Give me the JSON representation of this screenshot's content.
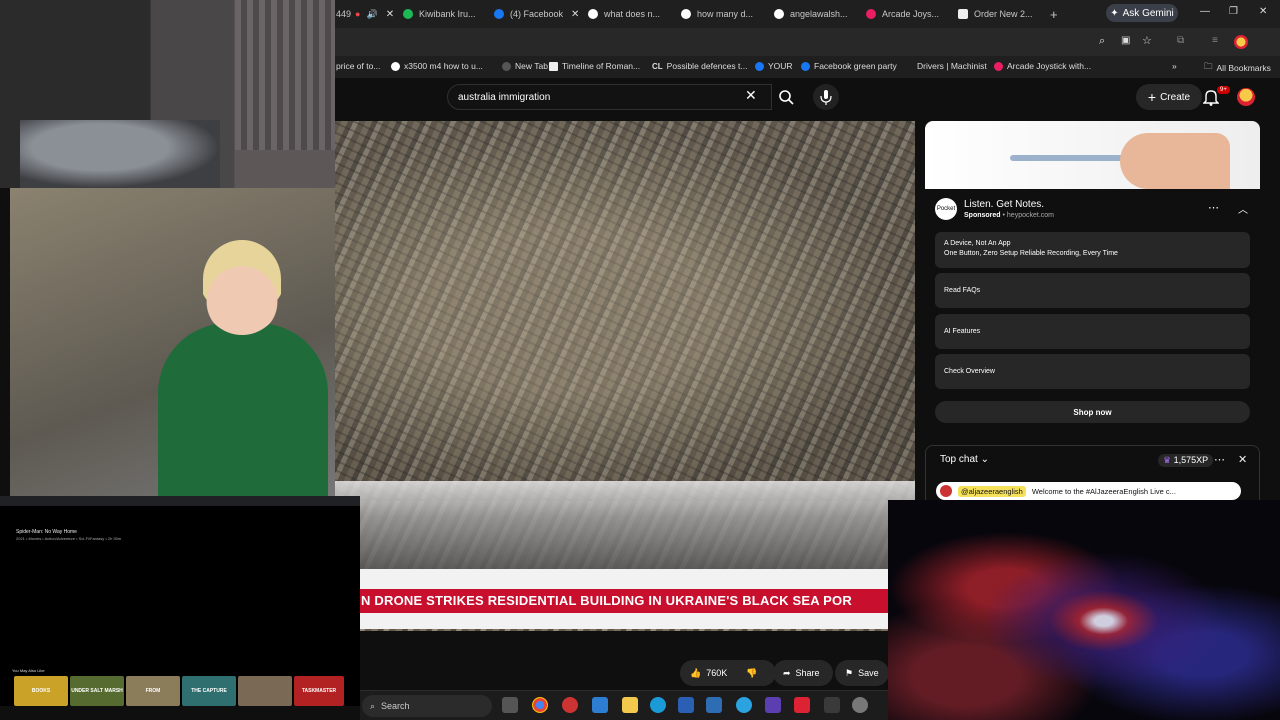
{
  "tabs": [
    {
      "label": "Kiwibank Iru...",
      "color": "#1db954"
    },
    {
      "label": "(4) Facebook",
      "color": "#1877f2"
    },
    {
      "label": "what does n...",
      "color": "#ffffff"
    },
    {
      "label": "how many d...",
      "color": "#ffffff"
    },
    {
      "label": "angelawalsh...",
      "color": "#ffffff"
    },
    {
      "label": "Arcade Joys...",
      "color": "#e91e63"
    },
    {
      "label": "Order New 2...",
      "color": "#eeeeee"
    }
  ],
  "partial_tab_count": "449",
  "gemini_label": "Ask Gemini",
  "bookmarks": [
    "price of to...",
    "x3500 m4 how to u...",
    "New Tab",
    "Timeline of Roman...",
    "Possible defences t...",
    "YOUR",
    "Facebook green party",
    "Drivers | Machinist",
    "Arcade Joystick with..."
  ],
  "all_bookmarks": "All Bookmarks",
  "search": {
    "value": "australia immigration"
  },
  "create_label": "Create",
  "notif_count": "9+",
  "ticker": "N DRONE STRIKES RESIDENTIAL BUILDING IN UKRAINE'S BLACK SEA POR",
  "actions": {
    "likes": "760K",
    "share": "Share",
    "save": "Save"
  },
  "ad": {
    "logo": "Pocket",
    "title": "Listen. Get Notes.",
    "sponsored": "Sponsored",
    "domain": "heypocket.com",
    "rows": [
      {
        "title": "A Device, Not An App",
        "subtitle": "One Button, Zero Setup Reliable Recording, Every Time"
      },
      {
        "title": "Read FAQs"
      },
      {
        "title": "AI Features"
      },
      {
        "title": "Check Overview"
      }
    ],
    "shop": "Shop now"
  },
  "chat": {
    "title": "Top chat",
    "xp": "1,575XP",
    "user": "@aljazeeraenglish",
    "message": "Welcome to the #AlJazeeraEnglish Live c..."
  },
  "netflix": {
    "title": "Spider-Man: No Way Home",
    "meta": "2021 • Movies • Action/Adventure • Sci-Fi/Fantasy • 2h 30m",
    "like": "You May Also Like",
    "posters": [
      {
        "label": "BOOKS",
        "color": "#c9a227"
      },
      {
        "label": "UNDER SALT MARSH",
        "color": "#556b2f"
      },
      {
        "label": "FROM",
        "color": "#8b7d5a"
      },
      {
        "label": "THE CAPTURE",
        "color": "#2f6f6f"
      },
      {
        "label": "",
        "color": "#7a6a55"
      },
      {
        "label": "TASKMASTER",
        "color": "#b22222"
      }
    ]
  },
  "taskbar": {
    "search": "Search"
  }
}
